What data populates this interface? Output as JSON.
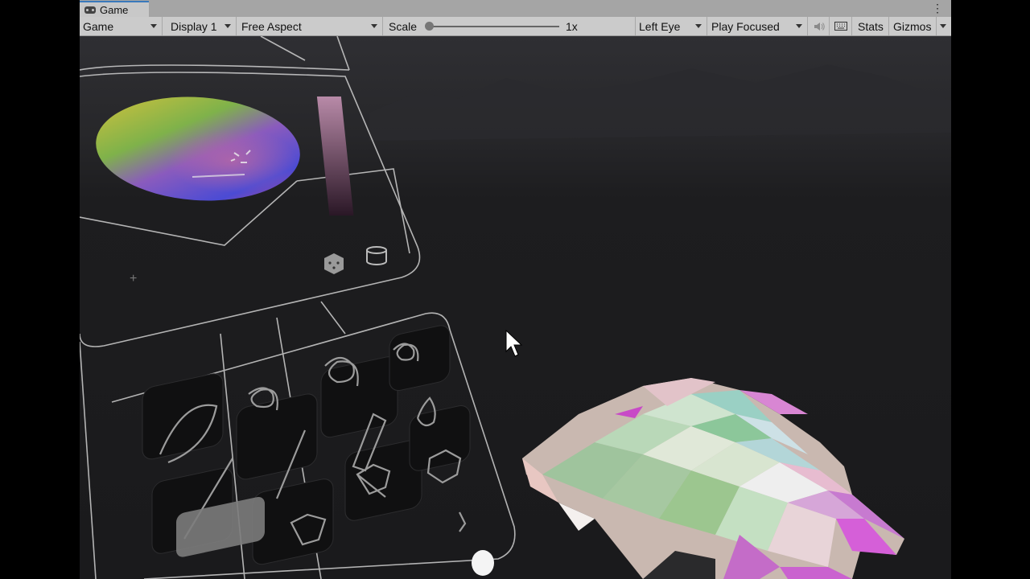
{
  "tab": {
    "label": "Game"
  },
  "toolbar": {
    "view_mode": "Game",
    "display": "Display 1",
    "aspect": "Free Aspect",
    "scale_label": "Scale",
    "scale_value": "1x",
    "eye": "Left Eye",
    "play_mode": "Play Focused",
    "stats": "Stats",
    "gizmos": "Gizmos"
  },
  "colors": {
    "tab_accent": "#3a79bb",
    "toolbar_bg": "#cbcbcb",
    "scene_bg": "#1b1b1d"
  }
}
